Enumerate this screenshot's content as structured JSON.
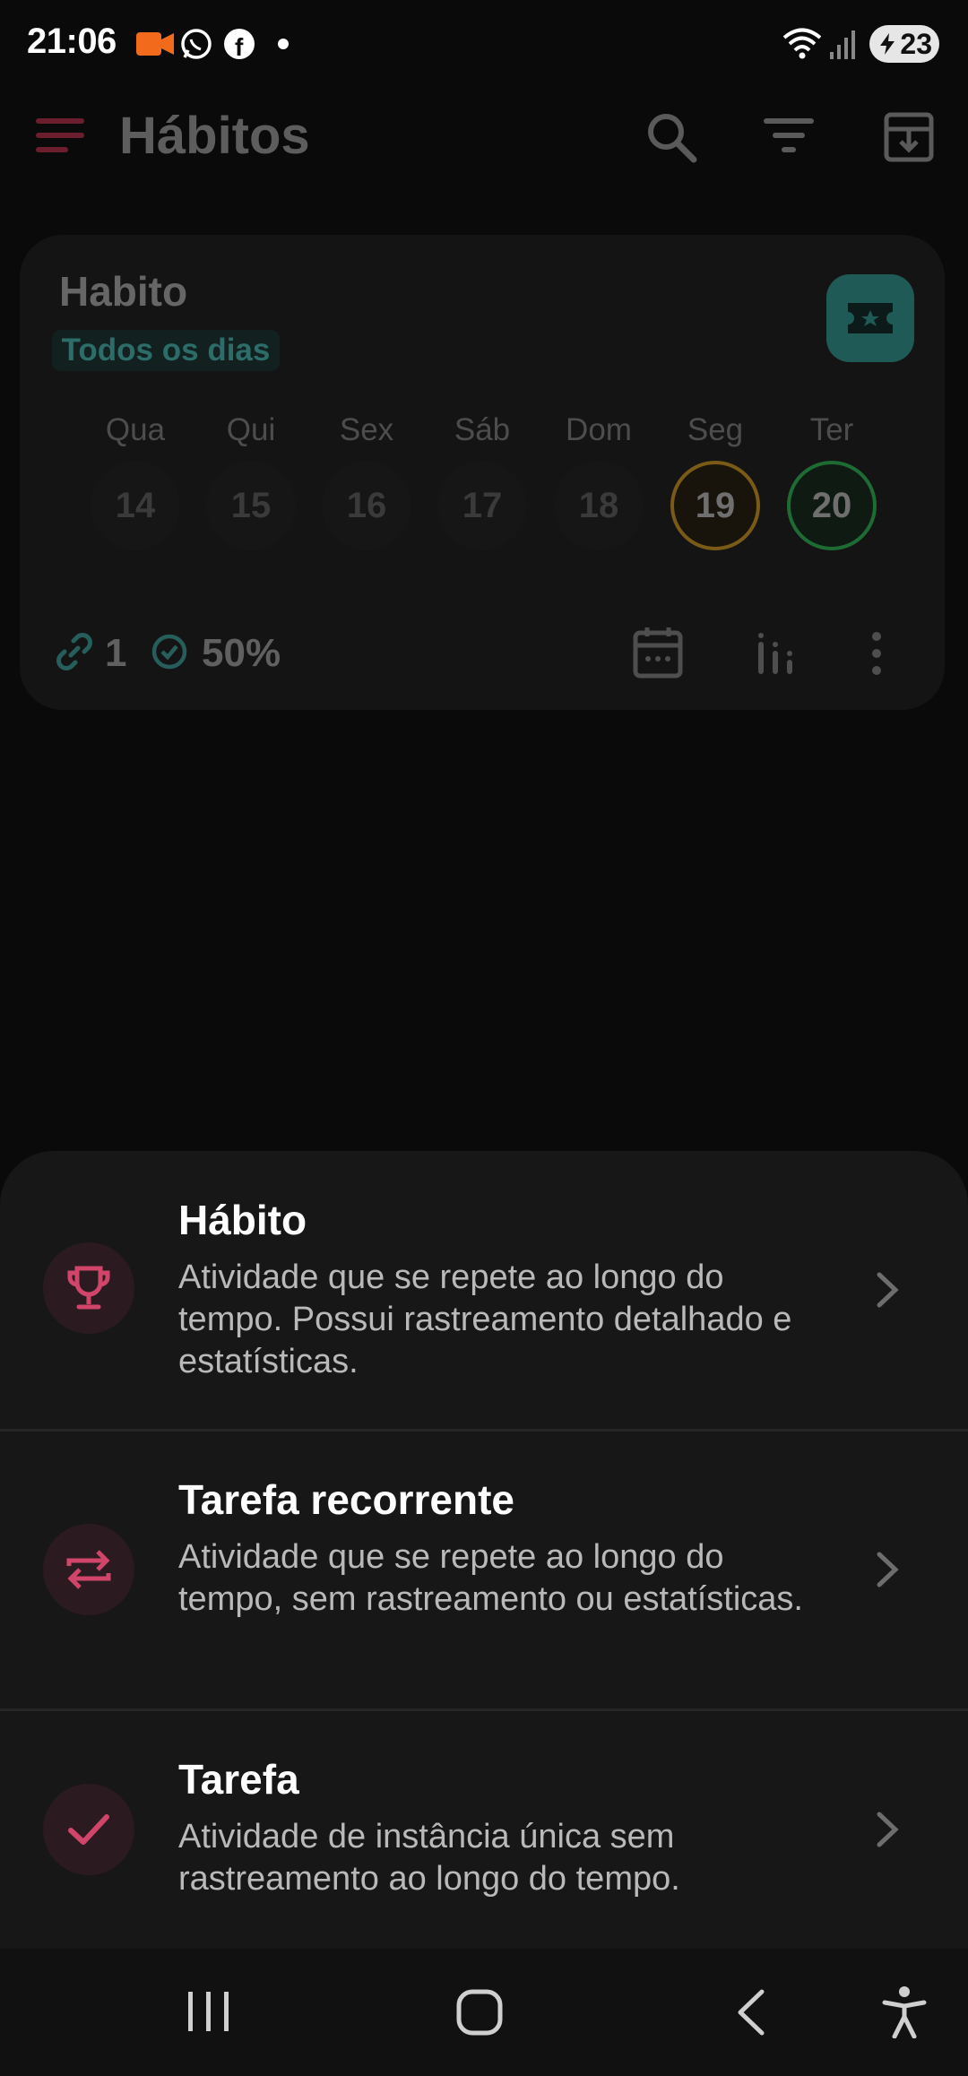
{
  "status": {
    "time": "21:06",
    "battery": "23"
  },
  "appbar": {
    "title": "Hábitos"
  },
  "card": {
    "title": "Habito",
    "frequency": "Todos os dias",
    "days": [
      {
        "label": "Qua",
        "num": "14",
        "state": "none"
      },
      {
        "label": "Qui",
        "num": "15",
        "state": "none"
      },
      {
        "label": "Sex",
        "num": "16",
        "state": "none"
      },
      {
        "label": "Sáb",
        "num": "17",
        "state": "none"
      },
      {
        "label": "Dom",
        "num": "18",
        "state": "none"
      },
      {
        "label": "Seg",
        "num": "19",
        "state": "pending"
      },
      {
        "label": "Ter",
        "num": "20",
        "state": "done"
      }
    ],
    "links": "1",
    "percent": "50%"
  },
  "sheet": {
    "options": [
      {
        "title": "Hábito",
        "desc": "Atividade que se repete ao longo do tempo. Possui rastreamento detalhado e estatísticas.",
        "icon": "trophy-icon"
      },
      {
        "title": "Tarefa recorrente",
        "desc": "Atividade que se repete ao longo do tempo, sem rastreamento ou estatísticas.",
        "icon": "repeat-icon"
      },
      {
        "title": "Tarefa",
        "desc": "Atividade de instância única sem rastreamento ao longo do tempo.",
        "icon": "check-icon"
      }
    ]
  },
  "colors": {
    "accent": "#d2456a",
    "teal": "#2a7a76",
    "yellow": "#7a5a17",
    "green": "#1f6b34"
  }
}
